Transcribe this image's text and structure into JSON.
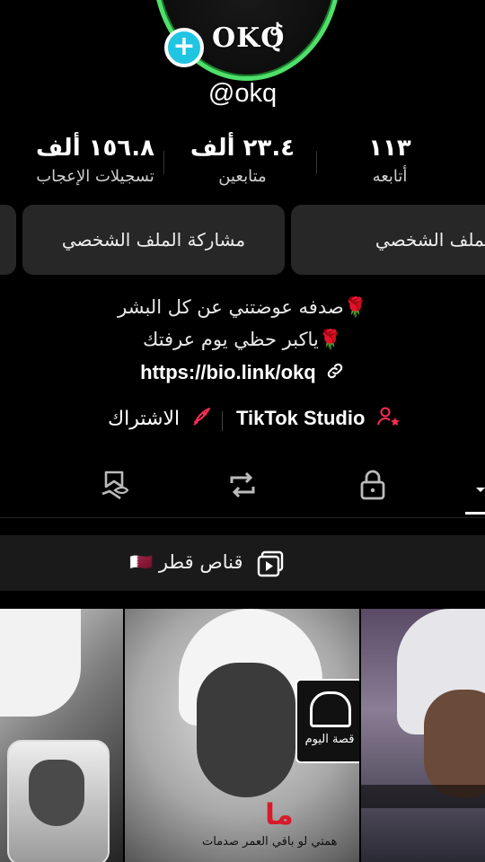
{
  "profile": {
    "username": "@okq",
    "avatar_logo": "OKQ",
    "add_icon": "plus-icon"
  },
  "stats": [
    {
      "value": "١٥٦.٨ ألف",
      "label": "تسجيلات الإعجاب"
    },
    {
      "value": "٢٣.٤ ألف",
      "label": "متابعين"
    },
    {
      "value": "١١٣",
      "label": "أتابعه"
    }
  ],
  "buttons": {
    "share": "مشاركة الملف الشخصي",
    "edit": "تعديل الملف الشخصي"
  },
  "bio": {
    "line1": "صدفه عوضتني عن كل البشر🌹",
    "line2": "ياكبر حظي يوم عرفتك🌹",
    "link": "https://bio.link/okq"
  },
  "links": {
    "subscribe": "الاشتراك",
    "studio": "TikTok Studio"
  },
  "playlist": {
    "label": "قناص قطر 🇶🇦"
  },
  "grid": {
    "overlay_text_1": "ما",
    "overlay_text_2": "همتي لو باقي العمر صدمات",
    "overlay_text_3": "قصة اليوم"
  },
  "colors": {
    "accent": "#20c5e2",
    "pink": "#fe2c55",
    "ring": "#4fe06a",
    "card": "#272727"
  }
}
